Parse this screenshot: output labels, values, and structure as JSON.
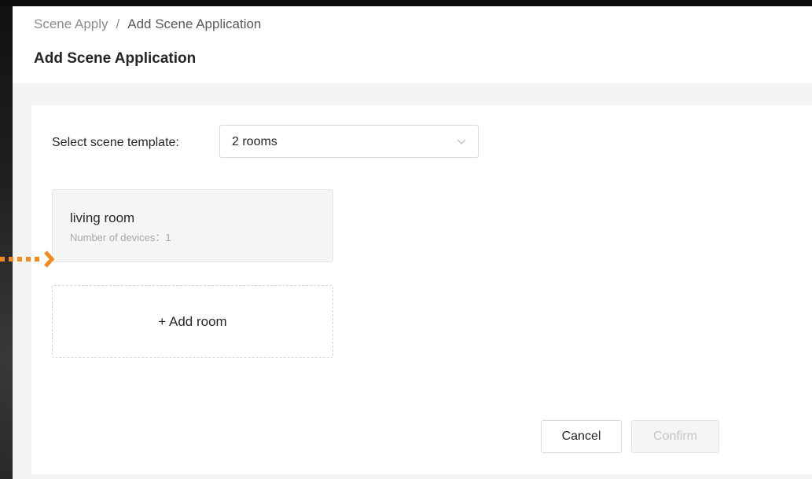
{
  "breadcrumb": {
    "root": "Scene Apply",
    "separator": "/",
    "current": "Add Scene Application"
  },
  "page_title": "Add Scene Application",
  "template": {
    "label": "Select scene template:",
    "selected": "2 rooms",
    "icon": "chevron-down-icon"
  },
  "rooms": [
    {
      "name": "living room",
      "devices_text": "Number of devices：1"
    }
  ],
  "add_room_label": "+ Add room",
  "actions": {
    "cancel": "Cancel",
    "confirm": "Confirm"
  },
  "colors": {
    "annotation_arrow": "#f08c1e",
    "confirm_disabled_text": "#c4c4c4"
  }
}
